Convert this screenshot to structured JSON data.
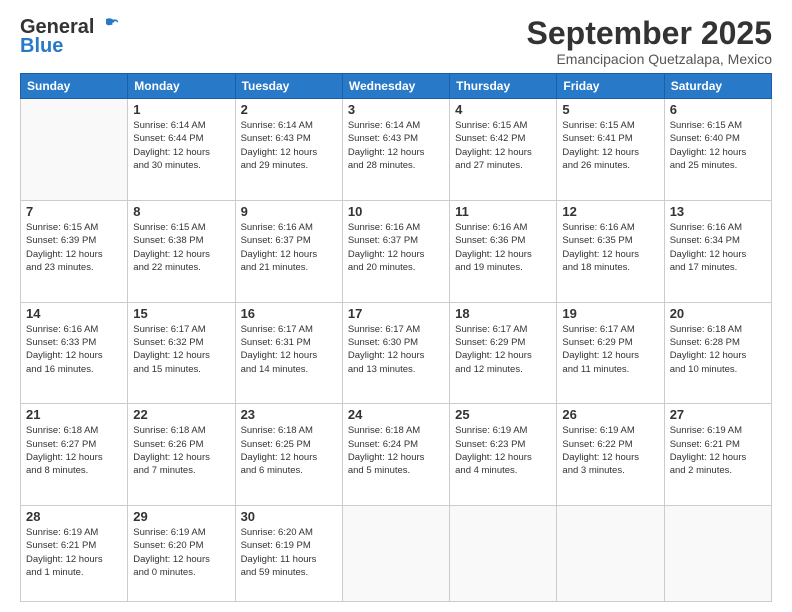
{
  "logo": {
    "general": "General",
    "blue": "Blue"
  },
  "header": {
    "month": "September 2025",
    "location": "Emancipacion Quetzalapa, Mexico"
  },
  "weekdays": [
    "Sunday",
    "Monday",
    "Tuesday",
    "Wednesday",
    "Thursday",
    "Friday",
    "Saturday"
  ],
  "weeks": [
    [
      {
        "day": "",
        "info": ""
      },
      {
        "day": "1",
        "info": "Sunrise: 6:14 AM\nSunset: 6:44 PM\nDaylight: 12 hours\nand 30 minutes."
      },
      {
        "day": "2",
        "info": "Sunrise: 6:14 AM\nSunset: 6:43 PM\nDaylight: 12 hours\nand 29 minutes."
      },
      {
        "day": "3",
        "info": "Sunrise: 6:14 AM\nSunset: 6:43 PM\nDaylight: 12 hours\nand 28 minutes."
      },
      {
        "day": "4",
        "info": "Sunrise: 6:15 AM\nSunset: 6:42 PM\nDaylight: 12 hours\nand 27 minutes."
      },
      {
        "day": "5",
        "info": "Sunrise: 6:15 AM\nSunset: 6:41 PM\nDaylight: 12 hours\nand 26 minutes."
      },
      {
        "day": "6",
        "info": "Sunrise: 6:15 AM\nSunset: 6:40 PM\nDaylight: 12 hours\nand 25 minutes."
      }
    ],
    [
      {
        "day": "7",
        "info": "Sunrise: 6:15 AM\nSunset: 6:39 PM\nDaylight: 12 hours\nand 23 minutes."
      },
      {
        "day": "8",
        "info": "Sunrise: 6:15 AM\nSunset: 6:38 PM\nDaylight: 12 hours\nand 22 minutes."
      },
      {
        "day": "9",
        "info": "Sunrise: 6:16 AM\nSunset: 6:37 PM\nDaylight: 12 hours\nand 21 minutes."
      },
      {
        "day": "10",
        "info": "Sunrise: 6:16 AM\nSunset: 6:37 PM\nDaylight: 12 hours\nand 20 minutes."
      },
      {
        "day": "11",
        "info": "Sunrise: 6:16 AM\nSunset: 6:36 PM\nDaylight: 12 hours\nand 19 minutes."
      },
      {
        "day": "12",
        "info": "Sunrise: 6:16 AM\nSunset: 6:35 PM\nDaylight: 12 hours\nand 18 minutes."
      },
      {
        "day": "13",
        "info": "Sunrise: 6:16 AM\nSunset: 6:34 PM\nDaylight: 12 hours\nand 17 minutes."
      }
    ],
    [
      {
        "day": "14",
        "info": "Sunrise: 6:16 AM\nSunset: 6:33 PM\nDaylight: 12 hours\nand 16 minutes."
      },
      {
        "day": "15",
        "info": "Sunrise: 6:17 AM\nSunset: 6:32 PM\nDaylight: 12 hours\nand 15 minutes."
      },
      {
        "day": "16",
        "info": "Sunrise: 6:17 AM\nSunset: 6:31 PM\nDaylight: 12 hours\nand 14 minutes."
      },
      {
        "day": "17",
        "info": "Sunrise: 6:17 AM\nSunset: 6:30 PM\nDaylight: 12 hours\nand 13 minutes."
      },
      {
        "day": "18",
        "info": "Sunrise: 6:17 AM\nSunset: 6:29 PM\nDaylight: 12 hours\nand 12 minutes."
      },
      {
        "day": "19",
        "info": "Sunrise: 6:17 AM\nSunset: 6:29 PM\nDaylight: 12 hours\nand 11 minutes."
      },
      {
        "day": "20",
        "info": "Sunrise: 6:18 AM\nSunset: 6:28 PM\nDaylight: 12 hours\nand 10 minutes."
      }
    ],
    [
      {
        "day": "21",
        "info": "Sunrise: 6:18 AM\nSunset: 6:27 PM\nDaylight: 12 hours\nand 8 minutes."
      },
      {
        "day": "22",
        "info": "Sunrise: 6:18 AM\nSunset: 6:26 PM\nDaylight: 12 hours\nand 7 minutes."
      },
      {
        "day": "23",
        "info": "Sunrise: 6:18 AM\nSunset: 6:25 PM\nDaylight: 12 hours\nand 6 minutes."
      },
      {
        "day": "24",
        "info": "Sunrise: 6:18 AM\nSunset: 6:24 PM\nDaylight: 12 hours\nand 5 minutes."
      },
      {
        "day": "25",
        "info": "Sunrise: 6:19 AM\nSunset: 6:23 PM\nDaylight: 12 hours\nand 4 minutes."
      },
      {
        "day": "26",
        "info": "Sunrise: 6:19 AM\nSunset: 6:22 PM\nDaylight: 12 hours\nand 3 minutes."
      },
      {
        "day": "27",
        "info": "Sunrise: 6:19 AM\nSunset: 6:21 PM\nDaylight: 12 hours\nand 2 minutes."
      }
    ],
    [
      {
        "day": "28",
        "info": "Sunrise: 6:19 AM\nSunset: 6:21 PM\nDaylight: 12 hours\nand 1 minute."
      },
      {
        "day": "29",
        "info": "Sunrise: 6:19 AM\nSunset: 6:20 PM\nDaylight: 12 hours\nand 0 minutes."
      },
      {
        "day": "30",
        "info": "Sunrise: 6:20 AM\nSunset: 6:19 PM\nDaylight: 11 hours\nand 59 minutes."
      },
      {
        "day": "",
        "info": ""
      },
      {
        "day": "",
        "info": ""
      },
      {
        "day": "",
        "info": ""
      },
      {
        "day": "",
        "info": ""
      }
    ]
  ]
}
